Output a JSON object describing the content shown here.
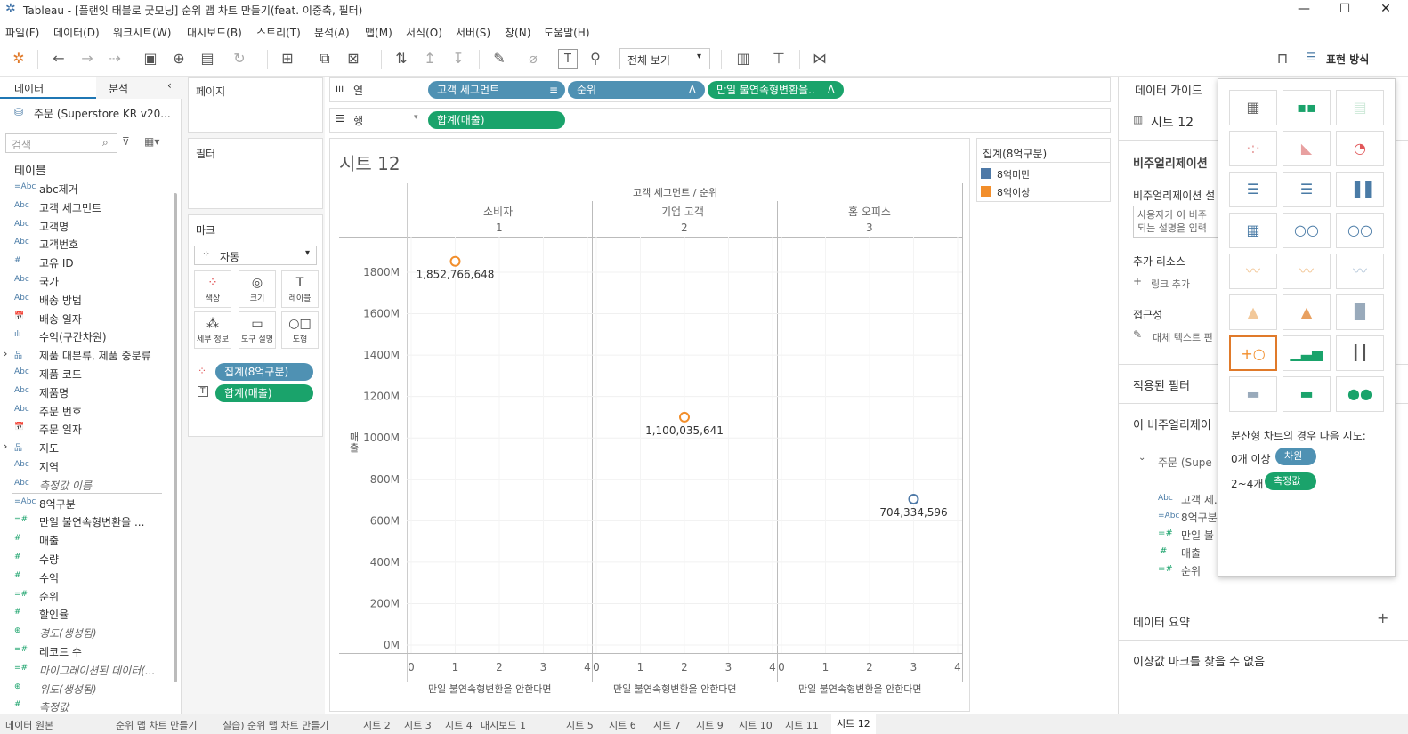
{
  "window": {
    "title": "Tableau - [플랜잇 태블로 굿모닝] 순위 맵 차트 만들기(feat. 이중축, 필터)",
    "minimize": "—",
    "maximize": "☐",
    "close": "✕"
  },
  "menu": [
    "파일(F)",
    "데이터(D)",
    "워크시트(W)",
    "대시보드(B)",
    "스토리(T)",
    "분석(A)",
    "맵(M)",
    "서식(O)",
    "서버(S)",
    "창(N)",
    "도움말(H)"
  ],
  "toolbar": {
    "view_select": "전체 보기",
    "showme_label": "표현 방식"
  },
  "left": {
    "tab_data": "데이터",
    "tab_analysis": "분석",
    "datasource": "주문 (Superstore KR v20...",
    "search_placeholder": "검색",
    "tables_label": "테이블",
    "fields": [
      {
        "icon": "=Abc",
        "name": "abc제거",
        "type": "dim"
      },
      {
        "icon": "Abc",
        "name": "고객 세그먼트",
        "type": "dim"
      },
      {
        "icon": "Abc",
        "name": "고객명",
        "type": "dim"
      },
      {
        "icon": "Abc",
        "name": "고객번호",
        "type": "dim"
      },
      {
        "icon": "#",
        "name": "고유 ID",
        "type": "dim"
      },
      {
        "icon": "Abc",
        "name": "국가",
        "type": "dim"
      },
      {
        "icon": "Abc",
        "name": "배송 방법",
        "type": "dim"
      },
      {
        "icon": "📅",
        "name": "배송 일자",
        "type": "dim"
      },
      {
        "icon": "ılı",
        "name": "수익(구간차원)",
        "type": "dim"
      },
      {
        "icon": "品",
        "name": "제품 대분류, 제품 중분류",
        "type": "dim"
      },
      {
        "icon": "Abc",
        "name": "제품 코드",
        "type": "dim"
      },
      {
        "icon": "Abc",
        "name": "제품명",
        "type": "dim"
      },
      {
        "icon": "Abc",
        "name": "주문 번호",
        "type": "dim"
      },
      {
        "icon": "📅",
        "name": "주문 일자",
        "type": "dim"
      },
      {
        "icon": "品",
        "name": "지도",
        "type": "dim"
      },
      {
        "icon": "Abc",
        "name": "지역",
        "type": "dim"
      },
      {
        "icon": "Abc",
        "name": "측정값 이름",
        "type": "dim-it"
      },
      {
        "icon": "=Abc",
        "name": "8억구분",
        "type": "dim"
      },
      {
        "icon": "=#",
        "name": "만일 불연속형변환을 ...",
        "type": "mea"
      },
      {
        "icon": "#",
        "name": "매출",
        "type": "mea"
      },
      {
        "icon": "#",
        "name": "수량",
        "type": "mea"
      },
      {
        "icon": "#",
        "name": "수익",
        "type": "mea"
      },
      {
        "icon": "=#",
        "name": "순위",
        "type": "mea"
      },
      {
        "icon": "#",
        "name": "할인율",
        "type": "mea"
      },
      {
        "icon": "⊕",
        "name": "경도(생성됨)",
        "type": "mea-it"
      },
      {
        "icon": "=#",
        "name": "레코드 수",
        "type": "mea"
      },
      {
        "icon": "=#",
        "name": "마이그레이션된 데이터(...",
        "type": "mea-it"
      },
      {
        "icon": "⊕",
        "name": "위도(생성됨)",
        "type": "mea-it"
      },
      {
        "icon": "#",
        "name": "측정값",
        "type": "mea-it"
      }
    ]
  },
  "cards": {
    "pages": "페이지",
    "filters": "필터",
    "marks": "마크",
    "marks_type": "자동",
    "mark_buttons": [
      "색상",
      "크기",
      "레이블",
      "세부 정보",
      "도구 설명",
      "도형"
    ],
    "mark_pills": [
      "집계(8억구분)",
      "합계(매출)"
    ]
  },
  "shelves": {
    "columns_label": "열",
    "rows_label": "행",
    "columns": [
      "고객 세그먼트",
      "순위",
      "만일 불연속형변환을.."
    ],
    "rows": [
      "합계(매출)"
    ]
  },
  "sheet": {
    "title": "시트 12",
    "header_title": "고객 세그먼트 / 순위",
    "columns": [
      {
        "name": "소비자",
        "rank": "1"
      },
      {
        "name": "기업 고객",
        "rank": "2"
      },
      {
        "name": "홈 오피스",
        "rank": "3"
      }
    ],
    "x_axis_title": "만일 불연속형변환을 안한다면",
    "y_axis_title": "매출"
  },
  "legend": {
    "title": "집계(8억구분)",
    "items": [
      {
        "label": "8억미만",
        "color": "#4e79a7"
      },
      {
        "label": "8억이상",
        "color": "#f28e2b"
      }
    ]
  },
  "chart_data": {
    "type": "scatter",
    "panes": [
      "소비자",
      "기업 고객",
      "홈 오피스"
    ],
    "xlim": [
      0,
      4
    ],
    "ylim": [
      0,
      1900000000
    ],
    "y_ticks": [
      "0M",
      "200M",
      "400M",
      "600M",
      "800M",
      "1000M",
      "1200M",
      "1400M",
      "1600M",
      "1800M"
    ],
    "x_ticks": [
      "0",
      "1",
      "2",
      "3",
      "4"
    ],
    "points": [
      {
        "pane": "소비자",
        "x": 1,
        "y": 1852766648,
        "label": "1,852,766,648",
        "group": "8억이상"
      },
      {
        "pane": "기업 고객",
        "x": 2,
        "y": 1100035641,
        "label": "1,100,035,641",
        "group": "8억이상"
      },
      {
        "pane": "홈 오피스",
        "x": 3,
        "y": 704334596,
        "label": "704,334,596",
        "group": "8억미만"
      }
    ]
  },
  "right": {
    "tab": "데이터 가이드",
    "sheet_name": "시트 12",
    "viz_desc": "비주얼리제이션",
    "viz_desc_label": "비주얼리제이션 설",
    "desc_placeholder": "사용자가 이 비주 되는 설명을 입력",
    "resources": "추가 리소스",
    "add_link": "링크 추가",
    "accessibility": "접근성",
    "alt_text": "대체 텍스트 편",
    "applied_filters": "적용된 필터",
    "this_viz": "이 비주얼리제이",
    "source": "주문 (Supe",
    "fields": [
      "고객 세..",
      "8억구분",
      "만일 불",
      "매출",
      "순위"
    ],
    "summary": "데이터 요약",
    "outliers": "이상값 마크를 찾을 수 없음"
  },
  "showme": {
    "hint": "분산형 차트의 경우 다음 시도:",
    "row1_label": "0개 이상",
    "row1_pill": "차원",
    "row2_label": "2~4개",
    "row2_pill": "측정값"
  },
  "tabs": [
    "데이터 원본",
    "순위 맵 차트 만들기",
    "실습) 순위 맵 차트 만들기",
    "시트 2",
    "시트 3",
    "시트 4",
    "대시보드 1",
    "시트 5",
    "시트 6",
    "시트 7",
    "시트 9",
    "시트 10",
    "시트 11",
    "시트 12"
  ]
}
